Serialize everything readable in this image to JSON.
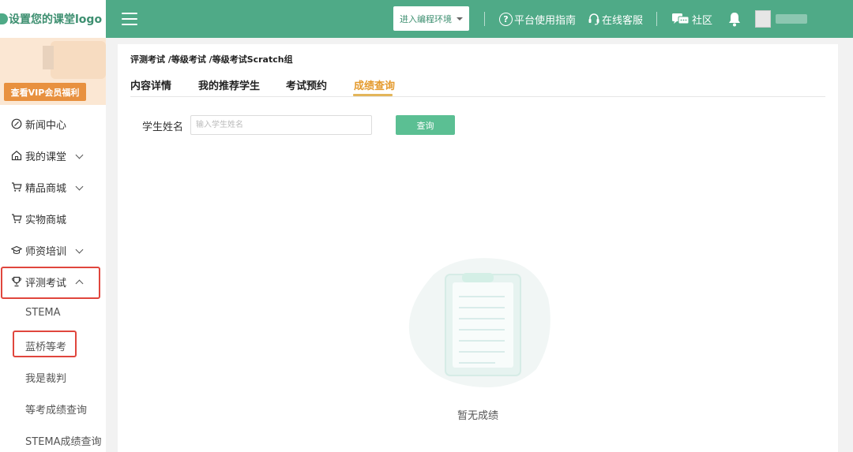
{
  "brand": {
    "logo_text": "设置您的课堂logo"
  },
  "topbar": {
    "env_button": "进入编程环境",
    "guide": "平台使用指南",
    "service": "在线客服",
    "community": "社区"
  },
  "sidebar": {
    "vip_button": "查看VIP会员福利",
    "items": [
      {
        "label": "新闻中心"
      },
      {
        "label": "我的课堂"
      },
      {
        "label": "精品商城"
      },
      {
        "label": "实物商城"
      },
      {
        "label": "师资培训"
      },
      {
        "label": "评测考试"
      }
    ],
    "sub_items": [
      {
        "label": "STEMA"
      },
      {
        "label": "蓝桥等考"
      },
      {
        "label": "我是裁判"
      },
      {
        "label": "等考成绩查询"
      },
      {
        "label": "STEMA成绩查询"
      }
    ]
  },
  "main": {
    "breadcrumb": "评测考试 /等级考试 /等级考试Scratch组",
    "tabs": [
      {
        "label": "内容详情"
      },
      {
        "label": "我的推荐学生"
      },
      {
        "label": "考试预约"
      },
      {
        "label": "成绩查询"
      }
    ],
    "search": {
      "label": "学生姓名",
      "placeholder": "输入学生姓名",
      "value": "",
      "button": "查询"
    },
    "empty_text": "暂无成绩"
  },
  "colors": {
    "brand_green": "#4faa87",
    "button_green": "#5bbf93",
    "active_tab": "#e49a2d",
    "vip_orange": "#e8913f",
    "highlight_red": "#e0463d"
  }
}
